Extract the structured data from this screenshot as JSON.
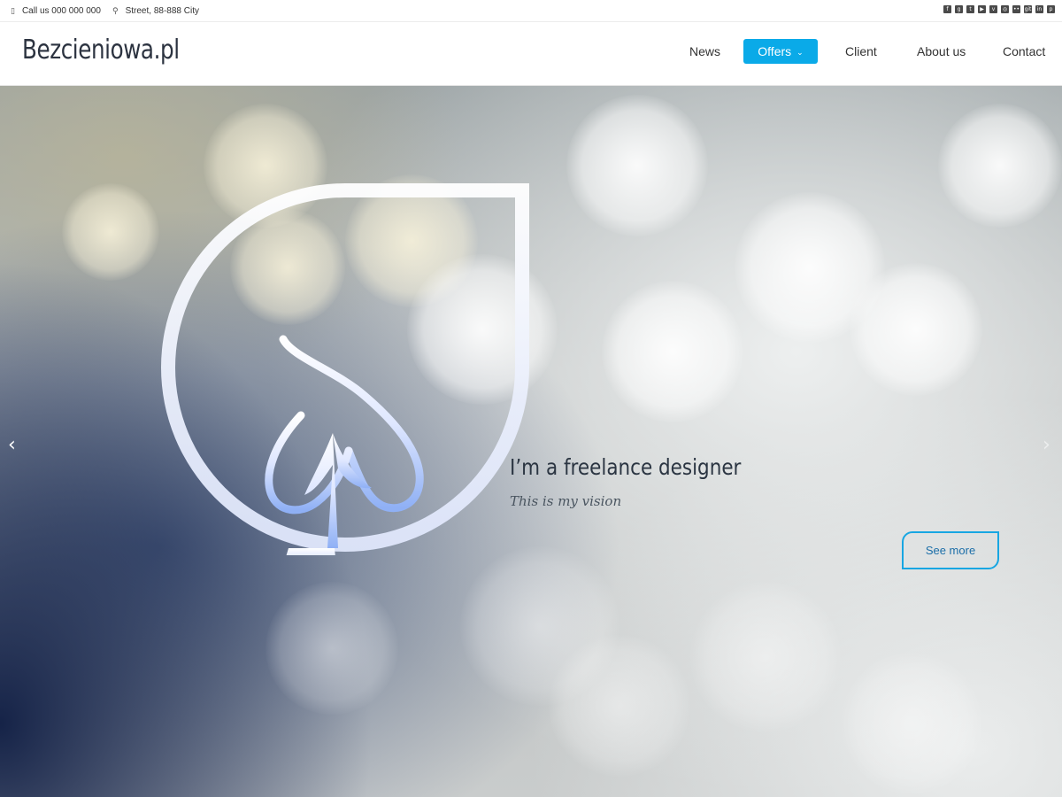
{
  "topbar": {
    "phone": "Call us 000 000 000",
    "phone_icon": "mobile-phone-icon",
    "address": "Street, 88-888 City",
    "address_icon": "map-marker-icon",
    "social": [
      {
        "name": "facebook-icon",
        "glyph": "f"
      },
      {
        "name": "google-plus-icon",
        "glyph": "g"
      },
      {
        "name": "twitter-icon",
        "glyph": "t"
      },
      {
        "name": "youtube-icon",
        "glyph": "▶"
      },
      {
        "name": "vimeo-icon",
        "glyph": "v"
      },
      {
        "name": "instagram-icon",
        "glyph": "◎"
      },
      {
        "name": "flickr-icon",
        "glyph": "••"
      },
      {
        "name": "github-icon",
        "glyph": "git"
      },
      {
        "name": "linkedin-icon",
        "glyph": "in"
      },
      {
        "name": "pinterest-icon",
        "glyph": "p"
      }
    ]
  },
  "header": {
    "logo": "Bezcieniowa.pl",
    "nav": [
      {
        "label": "News",
        "active": false
      },
      {
        "label": "Offers",
        "active": true,
        "dropdown": true
      },
      {
        "label": "Client",
        "active": false
      },
      {
        "label": "About us",
        "active": false
      },
      {
        "label": "Contact",
        "active": false
      }
    ],
    "accent_color": "#0aaae8"
  },
  "hero": {
    "headline": "I’m a freelance designer",
    "subline": "This is my vision",
    "cta_label": "See more",
    "prev_icon": "chevron-left-icon",
    "next_icon": "chevron-right-icon",
    "emblem_icon": "spade-drop-logo-icon"
  }
}
